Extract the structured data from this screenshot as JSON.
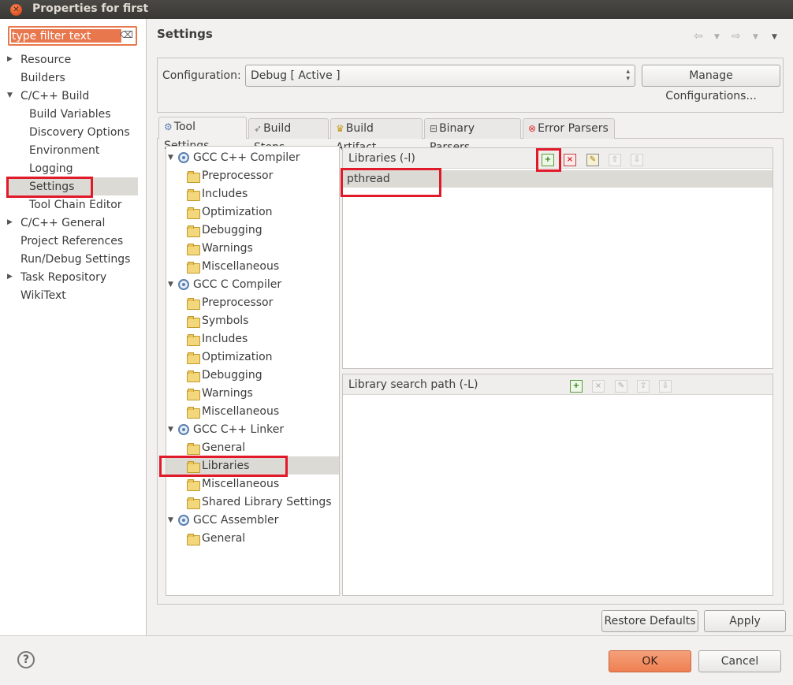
{
  "window": {
    "title": "Properties for first"
  },
  "filter": {
    "placeholder": "type filter text"
  },
  "nav": {
    "items": [
      {
        "label": "Resource",
        "level": 0,
        "arrow": true
      },
      {
        "label": "Builders",
        "level": 0,
        "arrow": false
      },
      {
        "label": "C/C++ Build",
        "level": 0,
        "arrow": "open"
      },
      {
        "label": "Build Variables",
        "level": 1
      },
      {
        "label": "Discovery Options",
        "level": 1
      },
      {
        "label": "Environment",
        "level": 1
      },
      {
        "label": "Logging",
        "level": 1
      },
      {
        "label": "Settings",
        "level": 1,
        "selected": true
      },
      {
        "label": "Tool Chain Editor",
        "level": 1
      },
      {
        "label": "C/C++ General",
        "level": 0,
        "arrow": true
      },
      {
        "label": "Project References",
        "level": 0
      },
      {
        "label": "Run/Debug Settings",
        "level": 0
      },
      {
        "label": "Task Repository",
        "level": 0,
        "arrow": true
      },
      {
        "label": "WikiText",
        "level": 0
      }
    ]
  },
  "page": {
    "title": "Settings"
  },
  "configuration": {
    "label": "Configuration:",
    "value": "Debug  [ Active ]",
    "manage_label": "Manage Configurations..."
  },
  "tabs": [
    {
      "label": "Tool Settings",
      "icon": "tool-settings-icon",
      "active": true
    },
    {
      "label": "Build Steps",
      "icon": "build-steps-icon"
    },
    {
      "label": "Build Artifact",
      "icon": "build-artifact-icon"
    },
    {
      "label": "Binary Parsers",
      "icon": "binary-parsers-icon"
    },
    {
      "label": "Error Parsers",
      "icon": "error-parsers-icon"
    }
  ],
  "tool_tree": [
    {
      "label": "GCC C++ Compiler",
      "type": "tool"
    },
    {
      "label": "Preprocessor",
      "type": "option"
    },
    {
      "label": "Includes",
      "type": "option"
    },
    {
      "label": "Optimization",
      "type": "option"
    },
    {
      "label": "Debugging",
      "type": "option"
    },
    {
      "label": "Warnings",
      "type": "option"
    },
    {
      "label": "Miscellaneous",
      "type": "option"
    },
    {
      "label": "GCC C Compiler",
      "type": "tool"
    },
    {
      "label": "Preprocessor",
      "type": "option"
    },
    {
      "label": "Symbols",
      "type": "option"
    },
    {
      "label": "Includes",
      "type": "option"
    },
    {
      "label": "Optimization",
      "type": "option"
    },
    {
      "label": "Debugging",
      "type": "option"
    },
    {
      "label": "Warnings",
      "type": "option"
    },
    {
      "label": "Miscellaneous",
      "type": "option"
    },
    {
      "label": "GCC C++ Linker",
      "type": "tool"
    },
    {
      "label": "General",
      "type": "option"
    },
    {
      "label": "Libraries",
      "type": "option",
      "selected": true
    },
    {
      "label": "Miscellaneous",
      "type": "option"
    },
    {
      "label": "Shared Library Settings",
      "type": "option"
    },
    {
      "label": "GCC Assembler",
      "type": "tool"
    },
    {
      "label": "General",
      "type": "option"
    }
  ],
  "libraries": {
    "title": "Libraries (-l)",
    "items": [
      "pthread"
    ]
  },
  "library_paths": {
    "title": "Library search path (-L)",
    "items": []
  },
  "buttons": {
    "restore": "Restore Defaults",
    "apply": "Apply",
    "ok": "OK",
    "cancel": "Cancel"
  },
  "help": {
    "glyph": "?"
  },
  "colors": {
    "highlight_box": "#e11a2a",
    "ok_button": "#f08a5f",
    "title_bar": "#3f3d3a"
  }
}
